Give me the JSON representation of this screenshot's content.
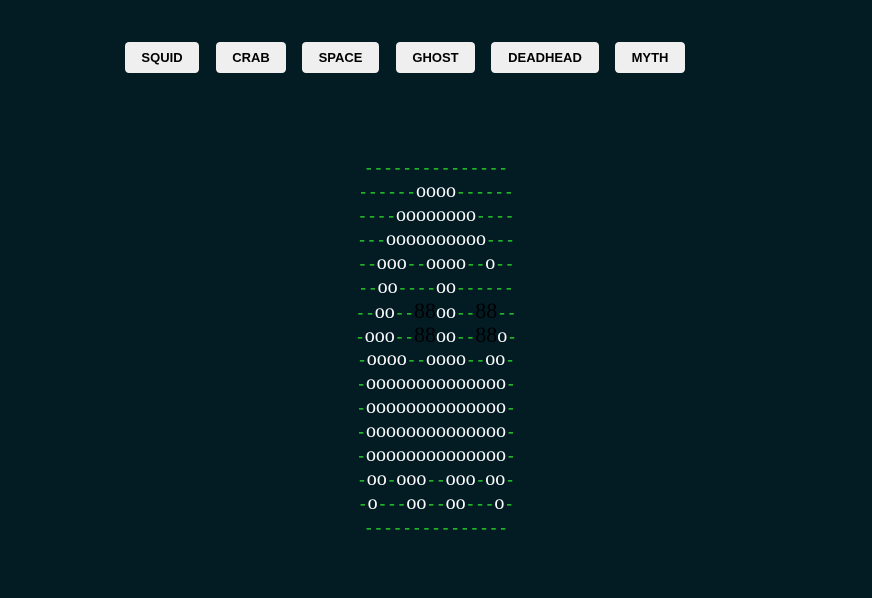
{
  "toolbar": {
    "buttons": [
      {
        "label": "SQUID"
      },
      {
        "label": "CRAB"
      },
      {
        "label": "SPACE"
      },
      {
        "label": "GHOST"
      },
      {
        "label": "DEADHEAD"
      },
      {
        "label": "MYTH"
      }
    ]
  },
  "art": {
    "lines": [
      "---------------",
      "------oooo------",
      "----oooooooo----",
      "---oooooooooo---",
      "--ooo--oooo--o--",
      "--oo----oo------",
      "--oo--88oo--88--",
      "-ooo--88oo--88o-",
      "-oooo--oooo--oo-",
      "-oooooooooooooo-",
      "-oooooooooooooo-",
      "-oooooooooooooo-",
      "-oooooooooooooo-",
      "-oo-ooo--ooo-oo-",
      "-o---oo--oo---o-",
      "---------------"
    ]
  },
  "colors": {
    "background": "#031c24",
    "dash": "#2ee62e",
    "o": "#ffffff",
    "eight": "#000000",
    "button_bg": "#efefef"
  }
}
